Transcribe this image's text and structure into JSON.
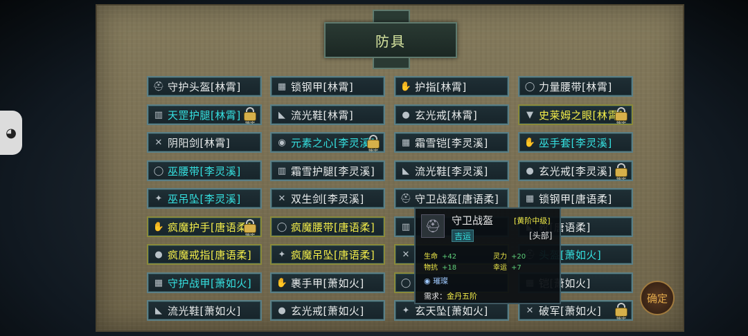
{
  "window": {
    "title": "防具"
  },
  "items": [
    {
      "name": "守护头盔[林霄]",
      "color": "white",
      "icon": "helmet-icon",
      "locked": false,
      "locked_label": ""
    },
    {
      "name": "锁钢甲[林霄]",
      "color": "white",
      "icon": "armor-icon",
      "locked": false,
      "locked_label": ""
    },
    {
      "name": "护指[林霄]",
      "color": "white",
      "icon": "finger-guard-icon",
      "locked": false,
      "locked_label": ""
    },
    {
      "name": "力量腰带[林霄]",
      "color": "white",
      "icon": "belt-icon",
      "locked": false,
      "locked_label": ""
    },
    {
      "name": "天罡护腿[林霄]",
      "color": "cyan",
      "icon": "leggings-icon",
      "locked": true,
      "locked_label": "锁定"
    },
    {
      "name": "流光鞋[林霄]",
      "color": "white",
      "icon": "boots-icon",
      "locked": false,
      "locked_label": ""
    },
    {
      "name": "玄光戒[林霄]",
      "color": "white",
      "icon": "ring-icon",
      "locked": false,
      "locked_label": ""
    },
    {
      "name": "史莱姆之眼[林霄]",
      "color": "yellow",
      "icon": "amulet-icon",
      "locked": true,
      "locked_label": "锁定"
    },
    {
      "name": "阴阳剑[林霄]",
      "color": "white",
      "icon": "sword-icon",
      "locked": false,
      "locked_label": ""
    },
    {
      "name": "元素之心[李灵溪]",
      "color": "cyan",
      "icon": "orb-icon",
      "locked": true,
      "locked_label": "锁定"
    },
    {
      "name": "霜雪铠[李灵溪]",
      "color": "white",
      "icon": "armor-icon",
      "locked": false,
      "locked_label": ""
    },
    {
      "name": "巫手套[李灵溪]",
      "color": "cyan",
      "icon": "glove-icon",
      "locked": false,
      "locked_label": ""
    },
    {
      "name": "巫腰带[李灵溪]",
      "color": "cyan",
      "icon": "belt-icon",
      "locked": false,
      "locked_label": ""
    },
    {
      "name": "霜雪护腿[李灵溪]",
      "color": "white",
      "icon": "leggings-icon",
      "locked": false,
      "locked_label": ""
    },
    {
      "name": "流光鞋[李灵溪]",
      "color": "white",
      "icon": "boots-icon",
      "locked": false,
      "locked_label": ""
    },
    {
      "name": "玄光戒[李灵溪]",
      "color": "white",
      "icon": "ring-icon",
      "locked": true,
      "locked_label": "锁定"
    },
    {
      "name": "巫吊坠[李灵溪]",
      "color": "cyan",
      "icon": "pendant-icon",
      "locked": false,
      "locked_label": ""
    },
    {
      "name": "双生剑[李灵溪]",
      "color": "white",
      "icon": "sword-icon",
      "locked": false,
      "locked_label": ""
    },
    {
      "name": "守卫战盔[唐语柔]",
      "color": "white",
      "icon": "helmet-icon",
      "locked": false,
      "locked_label": ""
    },
    {
      "name": "锁钢甲[唐语柔]",
      "color": "white",
      "icon": "armor-icon",
      "locked": false,
      "locked_label": ""
    },
    {
      "name": "疯魔护手[唐语柔]",
      "color": "yellow",
      "icon": "glove-icon",
      "locked": true,
      "locked_label": "锁定"
    },
    {
      "name": "疯魔腰带[唐语柔]",
      "color": "yellow",
      "icon": "belt-icon",
      "locked": false,
      "locked_label": ""
    },
    {
      "name": "",
      "color": "white",
      "icon": "leggings-icon",
      "locked": false,
      "locked_label": ""
    },
    {
      "name": "靴[唐语柔]",
      "color": "white",
      "icon": "boots-icon",
      "locked": false,
      "locked_label": ""
    },
    {
      "name": "疯魔戒指[唐语柔]",
      "color": "yellow",
      "icon": "ring-icon",
      "locked": false,
      "locked_label": ""
    },
    {
      "name": "疯魔吊坠[唐语柔]",
      "color": "yellow",
      "icon": "pendant-icon",
      "locked": false,
      "locked_label": ""
    },
    {
      "name": "",
      "color": "yellow",
      "icon": "sword-icon",
      "locked": false,
      "locked_label": ""
    },
    {
      "name": "头盔[萧如火]",
      "color": "cyan",
      "icon": "helmet-icon",
      "locked": false,
      "locked_label": ""
    },
    {
      "name": "守护战甲[萧如火]",
      "color": "cyan",
      "icon": "armor-icon",
      "locked": false,
      "locked_label": ""
    },
    {
      "name": "裹手甲[萧如火]",
      "color": "white",
      "icon": "glove-icon",
      "locked": false,
      "locked_label": ""
    },
    {
      "name": "",
      "color": "yellow",
      "icon": "belt-icon",
      "locked": false,
      "locked_label": ""
    },
    {
      "name": "铠[萧如火]",
      "color": "white",
      "icon": "armor-icon",
      "locked": false,
      "locked_label": ""
    },
    {
      "name": "流光鞋[萧如火]",
      "color": "white",
      "icon": "boots-icon",
      "locked": false,
      "locked_label": ""
    },
    {
      "name": "玄光戒[萧如火]",
      "color": "white",
      "icon": "ring-icon",
      "locked": false,
      "locked_label": ""
    },
    {
      "name": "玄天坠[萧如火]",
      "color": "white",
      "icon": "pendant-icon",
      "locked": false,
      "locked_label": ""
    },
    {
      "name": "破军[萧如火]",
      "color": "white",
      "icon": "sword-icon",
      "locked": true,
      "locked_label": "锁定"
    }
  ],
  "tooltip": {
    "name": "守卫战盔",
    "grade": "[黄阶中级]",
    "luck": "吉运",
    "slot": "[头部]",
    "stats": [
      {
        "label": "生命",
        "value": "+42"
      },
      {
        "label": "灵力",
        "value": "+20"
      },
      {
        "label": "物抗",
        "value": "+18"
      },
      {
        "label": "幸运",
        "value": "+7"
      }
    ],
    "skill": "璀璨",
    "require_label": "需求：",
    "require_value": "金丹五阶"
  },
  "confirm": {
    "label": "确定"
  },
  "icons": {
    "helmet-icon": "⛑",
    "armor-icon": "▦",
    "finger-guard-icon": "✋",
    "belt-icon": "◯",
    "leggings-icon": "▥",
    "boots-icon": "◣",
    "ring-icon": "●",
    "amulet-icon": "▼",
    "sword-icon": "✕",
    "orb-icon": "◉",
    "glove-icon": "✋",
    "pendant-icon": "✦"
  }
}
